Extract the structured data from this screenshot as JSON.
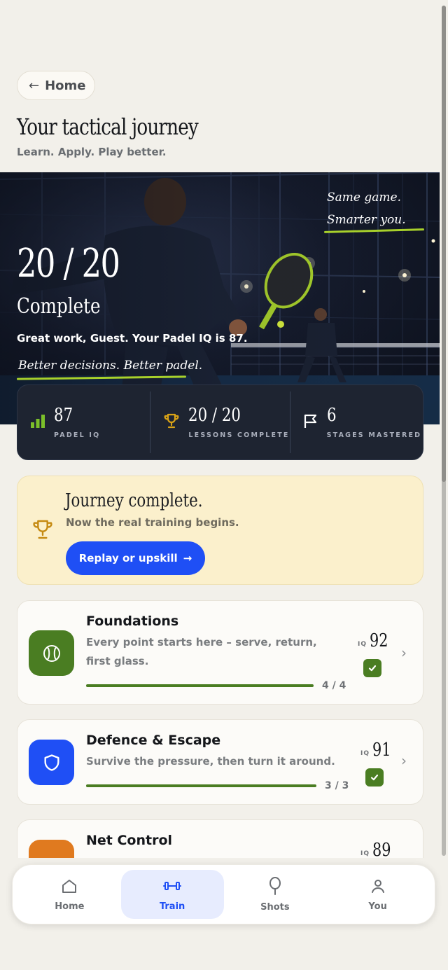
{
  "header": {
    "back_label": "Home",
    "title": "Your tactical journey",
    "subtitle": "Learn. Apply. Play better."
  },
  "hero": {
    "tagline_line1": "Same game.",
    "tagline_line2": "Smarter you.",
    "progress_text": "20 / 20",
    "status_text": "Complete",
    "message": "Great work, Guest. Your Padel IQ is 87.",
    "motto": "Better decisions. Better padel."
  },
  "stats": [
    {
      "value": "87",
      "label": "PADEL IQ",
      "icon": "bar-chart-icon"
    },
    {
      "value": "20 / 20",
      "label": "LESSONS COMPLETE",
      "icon": "trophy-icon"
    },
    {
      "value": "6",
      "label": "STAGES MASTERED",
      "icon": "flag-icon"
    }
  ],
  "journey": {
    "title": "Journey complete.",
    "subtitle": "Now the real training begins.",
    "button_label": "Replay or upskill",
    "button_arrow": "→"
  },
  "courses": [
    {
      "name": "Foundations",
      "description": "Every point starts here – serve, return, first glass.",
      "progress": "4 / 4",
      "progress_fraction": 1.0,
      "iq_tag": "IQ",
      "iq": "92",
      "completed": true,
      "icon": "tennis-ball-icon",
      "color": "#4a7d22"
    },
    {
      "name": "Defence & Escape",
      "description": "Survive the pressure, then turn it around.",
      "progress": "3 / 3",
      "progress_fraction": 1.0,
      "iq_tag": "IQ",
      "iq": "91",
      "completed": true,
      "icon": "shield-icon",
      "color": "#1f4ff5"
    },
    {
      "name": "Net Control",
      "iq_tag": "IQ",
      "iq": "89",
      "icon": "net-icon",
      "color": "#e07a1f"
    }
  ],
  "nav": [
    {
      "label": "Home",
      "icon": "home-icon",
      "active": false
    },
    {
      "label": "Train",
      "icon": "dumbbell-icon",
      "active": true
    },
    {
      "label": "Shots",
      "icon": "racket-icon",
      "active": false
    },
    {
      "label": "You",
      "icon": "user-icon",
      "active": false
    }
  ],
  "colors": {
    "accent": "#1f4ff5",
    "success": "#4a7d22",
    "highlight": "#a8d12b",
    "gold": "#c58a12",
    "dark_panel": "#1e2431",
    "background": "#f2f0ea"
  }
}
